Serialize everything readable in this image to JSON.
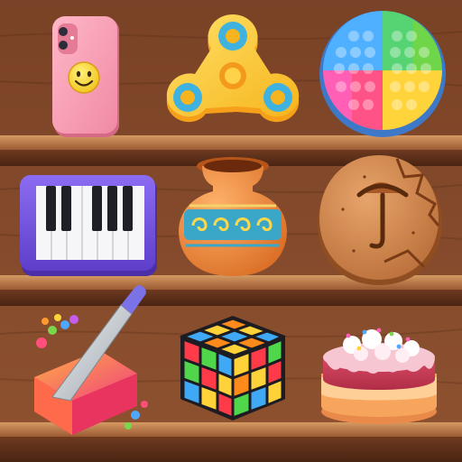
{
  "scene": {
    "background": "wooden-toy-shelf",
    "colors": {
      "wood_dark": "#5a2f1a",
      "wood_mid": "#8a4f2e",
      "wood_light": "#b87444",
      "shelf_edge": "#c98752"
    }
  },
  "grid": {
    "rows": 3,
    "cols": 3,
    "items": [
      {
        "id": "phone",
        "name": "pink-phone-with-smiley-case-icon",
        "interactable": true
      },
      {
        "id": "spinner",
        "name": "fidget-spinner-icon",
        "interactable": true
      },
      {
        "id": "popit",
        "name": "rainbow-pop-it-icon",
        "interactable": true
      },
      {
        "id": "piano",
        "name": "piano-keyboard-icon",
        "interactable": true
      },
      {
        "id": "vase",
        "name": "clay-vase-icon",
        "interactable": true
      },
      {
        "id": "cookie",
        "name": "dalgona-umbrella-cookie-icon",
        "interactable": true
      },
      {
        "id": "soap",
        "name": "soap-cutting-knife-icon",
        "interactable": true
      },
      {
        "id": "cube",
        "name": "rubiks-cube-icon",
        "interactable": true
      },
      {
        "id": "cake",
        "name": "layer-cake-icon",
        "interactable": true
      }
    ]
  }
}
